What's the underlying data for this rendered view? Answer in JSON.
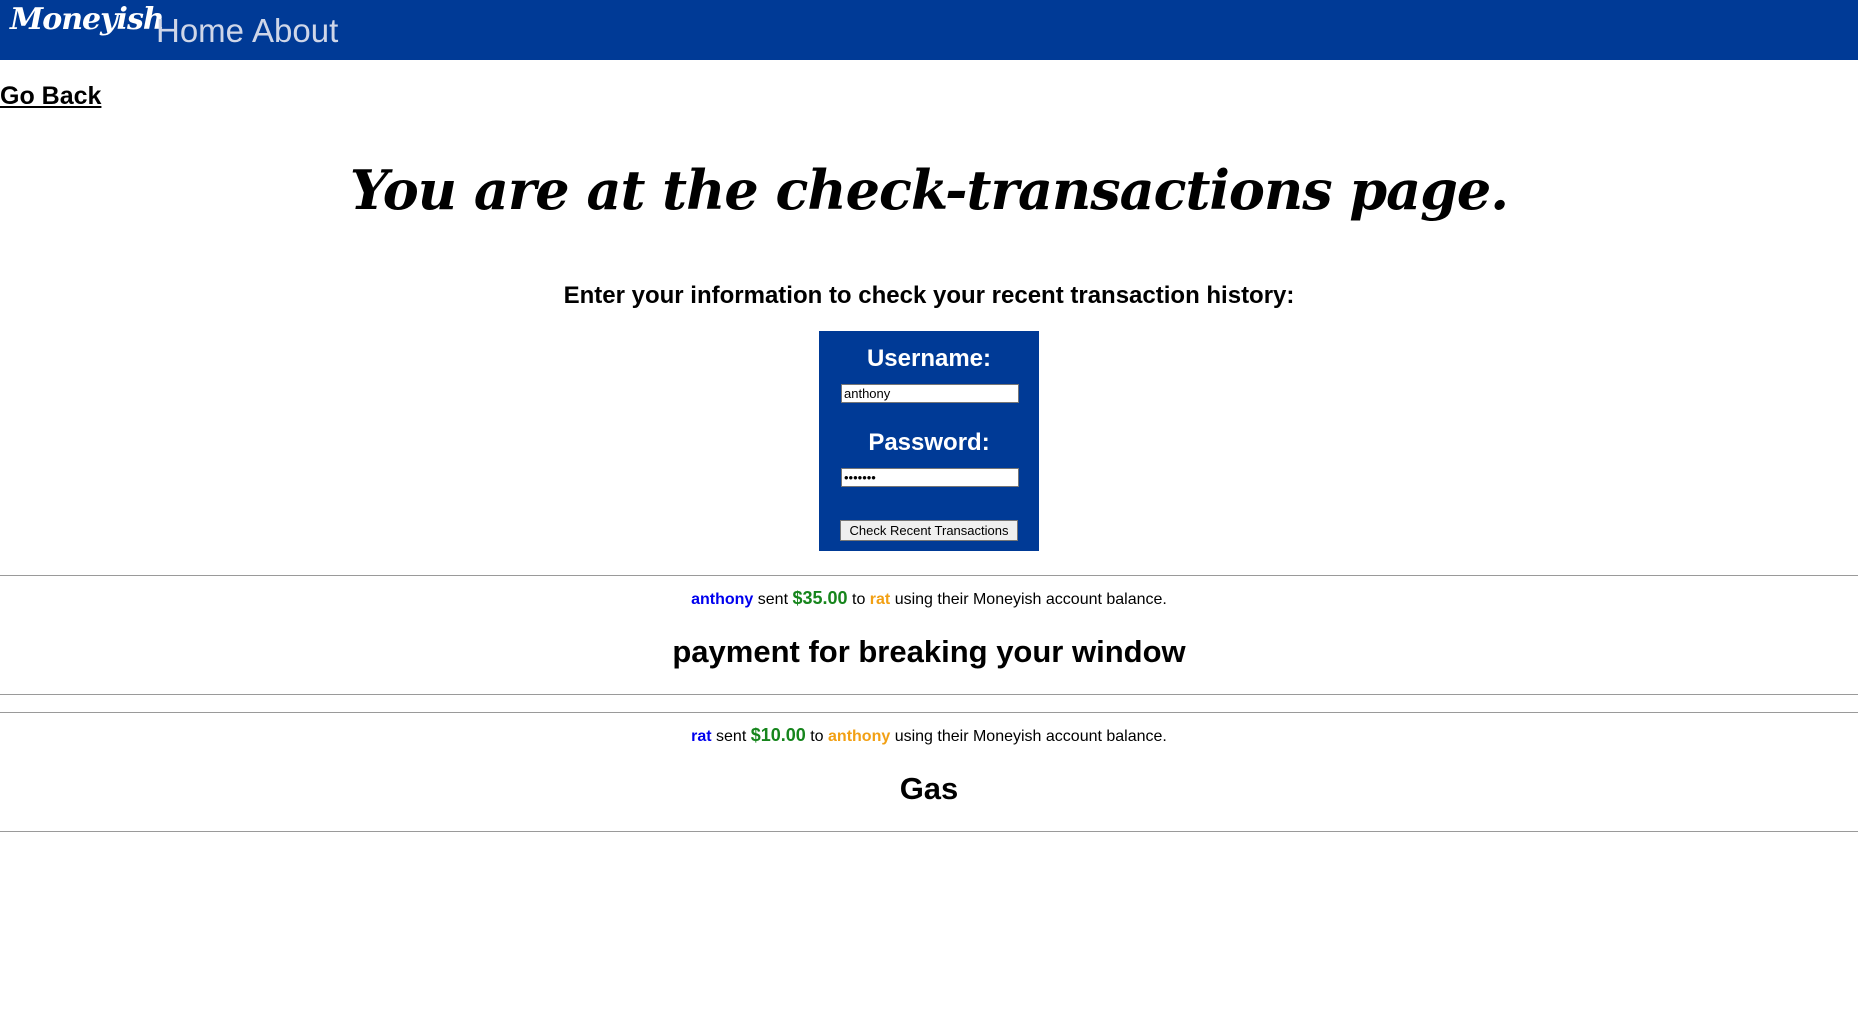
{
  "nav": {
    "brand": "Moneyish",
    "home_label": "Home",
    "about_label": "About"
  },
  "go_back_label": "Go Back",
  "page_title": "You are at the check-transactions page.",
  "instructions": "Enter your information to check your recent transaction history:",
  "form": {
    "username_label": "Username:",
    "username_value": "anthony",
    "password_label": "Password:",
    "password_value": "•••••••",
    "submit_label": "Check Recent Transactions"
  },
  "colors": {
    "navbar": "#003a96",
    "sender": "#0000ee",
    "amount": "#16851c",
    "recipient": "#f2a014"
  },
  "transactions": [
    {
      "sender": "anthony",
      "sent_word": "sent",
      "amount": "$35.00",
      "to_word": "to",
      "recipient": "rat",
      "method": "using their Moneyish account balance.",
      "memo": "payment for breaking your window"
    },
    {
      "sender": "rat",
      "sent_word": "sent",
      "amount": "$10.00",
      "to_word": "to",
      "recipient": "anthony",
      "method": "using their Moneyish account balance.",
      "memo": "Gas"
    }
  ]
}
